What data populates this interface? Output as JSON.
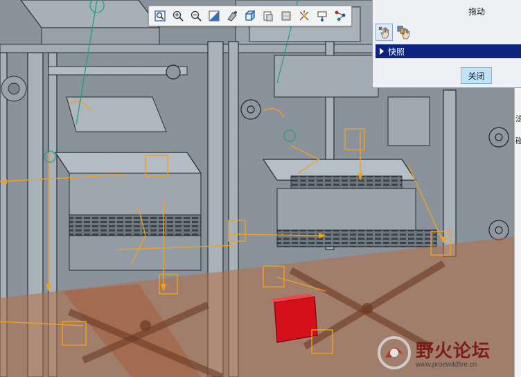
{
  "toolbar": {
    "buttons": [
      {
        "icon": "zoom-fit-icon"
      },
      {
        "icon": "zoom-in-icon"
      },
      {
        "icon": "zoom-out-icon"
      },
      {
        "icon": "repaint-icon"
      },
      {
        "icon": "display-style-icon"
      },
      {
        "icon": "saved-views-icon"
      },
      {
        "icon": "view-manager-icon"
      },
      {
        "icon": "section-icon"
      },
      {
        "icon": "datum-display-icon"
      },
      {
        "icon": "spin-center-icon"
      },
      {
        "icon": "annotation-display-icon"
      }
    ]
  },
  "dialog": {
    "title": "拖动",
    "tools": [
      {
        "icon": "point-drag-hand-icon",
        "active": true
      },
      {
        "icon": "body-drag-hand-icon",
        "active": false
      }
    ],
    "snapshot_label": "快照",
    "close_label": "关闭"
  },
  "side_panel": {
    "chars": [
      "泫",
      "碰"
    ]
  },
  "watermark": {
    "title": "野火论坛",
    "url": "www.proewildfire.cn"
  },
  "colors": {
    "model_steel": "#8c949c",
    "mechanism_orange": "#f0a020",
    "frame_brown": "#b56b45",
    "highlight_red": "#d6101a",
    "dialog_bar": "#0a2480",
    "close_button": "#bfe3f8"
  }
}
